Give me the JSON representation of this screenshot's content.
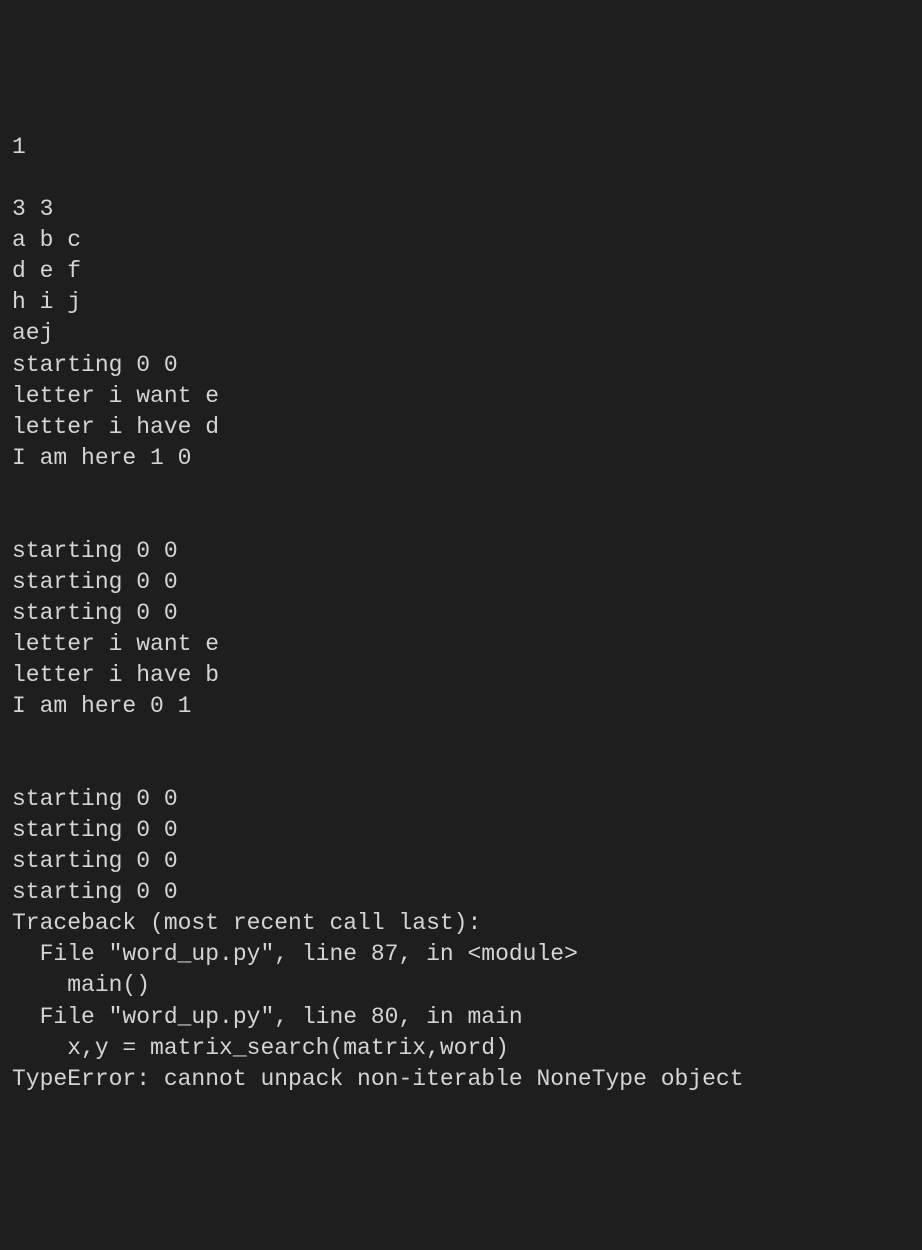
{
  "terminal": {
    "lines": [
      "1",
      "",
      "3 3",
      "a b c",
      "d e f",
      "h i j",
      "aej",
      "starting 0 0",
      "letter i want e",
      "letter i have d",
      "I am here 1 0",
      "",
      "",
      "starting 0 0",
      "starting 0 0",
      "starting 0 0",
      "letter i want e",
      "letter i have b",
      "I am here 0 1",
      "",
      "",
      "starting 0 0",
      "starting 0 0",
      "starting 0 0",
      "starting 0 0",
      "Traceback (most recent call last):",
      "  File \"word_up.py\", line 87, in <module>",
      "    main()",
      "  File \"word_up.py\", line 80, in main",
      "    x,y = matrix_search(matrix,word)",
      "TypeError: cannot unpack non-iterable NoneType object"
    ]
  }
}
